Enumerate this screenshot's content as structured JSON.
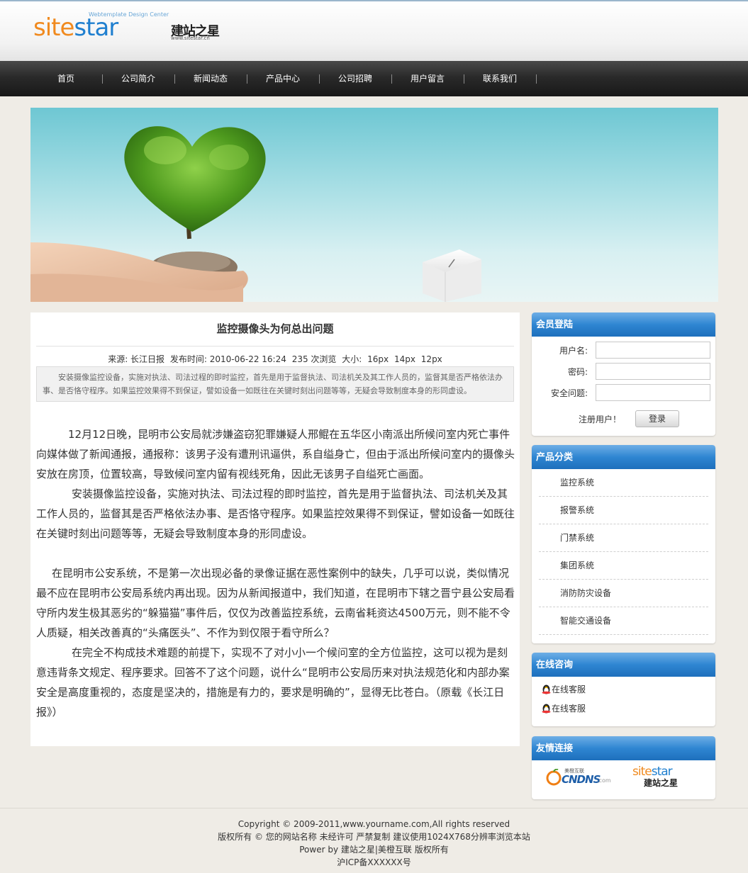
{
  "logo": {
    "brand_a": "site",
    "brand_b": "star",
    "tagline": "Webtemplate Design Center",
    "cn": "建站之星",
    "url": "www.sitestar.cn"
  },
  "nav": {
    "items": [
      "首页",
      "公司简介",
      "新闻动态",
      "产品中心",
      "公司招聘",
      "用户留言",
      "联系我们"
    ]
  },
  "article": {
    "title": "监控摄像头为何总出问题",
    "meta": {
      "source": "来源: 长江日报",
      "publish": "发布时间: 2010-06-22 16:24",
      "views": "235 次浏览",
      "size_label": "大小:",
      "size_options": [
        "16px",
        "14px",
        "12px"
      ]
    },
    "summary": "安装摄像监控设备，实施对执法、司法过程的即时监控，首先是用于监督执法、司法机关及其工作人员的，监督其是否严格依法办事、是否恪守程序。如果监控效果得不到保证，譬如设备一如既往在关键时刻出问题等等，无疑会导致制度本身的形同虚设。",
    "paragraphs": [
      "12月12日晚，昆明市公安局就涉嫌盗窃犯罪嫌疑人邢鲲在五华区小南派出所候问室内死亡事件向媒体做了新闻通报，通报称：该男子没有遭刑讯逼供，系自缢身亡，但由于派出所候问室内的摄像头安放在房顶，位置较高，导致候问室内留有视线死角，因此无该男子自缢死亡画面。",
      "安装摄像监控设备，实施对执法、司法过程的即时监控，首先是用于监督执法、司法机关及其工作人员的，监督其是否严格依法办事、是否恪守程序。如果监控效果得不到保证，譬如设备一如既往在关键时刻出问题等等，无疑会导致制度本身的形同虚设。",
      "在昆明市公安系统，不是第一次出现必备的录像证据在恶性案例中的缺失，几乎可以说，类似情况最不应在昆明市公安局系统内再出现。因为从新闻报道中，我们知道，在昆明市下辖之晋宁县公安局看守所内发生极其恶劣的“躲猫猫”事件后，仅仅为改善监控系统，云南省耗资达4500万元，则不能不令人质疑，相关改善真的“头痛医头”、不作为到仅限于看守所么？",
      "在完全不构成技术难题的前提下，实现不了对小小一个候问室的全方位监控，这可以视为是刻意违背条文规定、程序要求。回答不了这个问题，说什么“昆明市公安局历来对执法规范化和内部办案安全是高度重视的，态度是坚决的，措施是有力的，要求是明确的”，显得无比苍白。（原载《长江日报》）"
    ]
  },
  "login": {
    "title": "会员登陆",
    "username_label": "用户名:",
    "password_label": "密码:",
    "question_label": "安全问题:",
    "register": "注册用户！",
    "submit": "登录"
  },
  "categories": {
    "title": "产品分类",
    "items": [
      "监控系统",
      "报警系统",
      "门禁系统",
      "集团系统",
      "消防防灾设备",
      "智能交通设备"
    ]
  },
  "consult": {
    "title": "在线咨询",
    "items": [
      "在线客服",
      "在线客服"
    ]
  },
  "links": {
    "title": "友情连接",
    "link1_main": "CNDNS",
    "link1_small": "美橙互联",
    "link1_sub": ".com",
    "link2_a": "site",
    "link2_b": "star",
    "link2_cn": "建站之星"
  },
  "footer": {
    "lines": [
      "Copyright © 2009-2011,www.yourname.com,All rights reserved",
      "版权所有 © 您的网站名称 未经许可 严禁复制 建议使用1024X768分辨率浏览本站",
      "Power by 建站之星|美橙互联 版权所有",
      "沪ICP备XXXXXX号"
    ]
  },
  "colors": {
    "accent_blue": "#2f86d2",
    "brand_orange": "#f08a1f",
    "nav_dark": "#222222"
  }
}
